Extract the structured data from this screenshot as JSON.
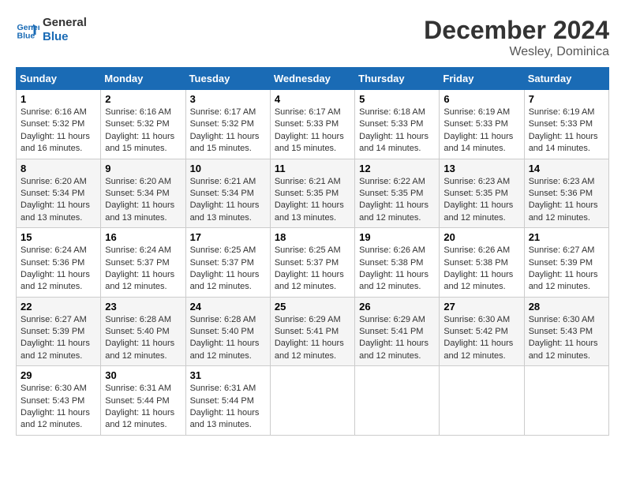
{
  "logo": {
    "line1": "General",
    "line2": "Blue"
  },
  "title": "December 2024",
  "location": "Wesley, Dominica",
  "days_of_week": [
    "Sunday",
    "Monday",
    "Tuesday",
    "Wednesday",
    "Thursday",
    "Friday",
    "Saturday"
  ],
  "weeks": [
    [
      {
        "day": "1",
        "sunrise": "6:16 AM",
        "sunset": "5:32 PM",
        "daylight": "11 hours and 16 minutes."
      },
      {
        "day": "2",
        "sunrise": "6:16 AM",
        "sunset": "5:32 PM",
        "daylight": "11 hours and 15 minutes."
      },
      {
        "day": "3",
        "sunrise": "6:17 AM",
        "sunset": "5:32 PM",
        "daylight": "11 hours and 15 minutes."
      },
      {
        "day": "4",
        "sunrise": "6:17 AM",
        "sunset": "5:33 PM",
        "daylight": "11 hours and 15 minutes."
      },
      {
        "day": "5",
        "sunrise": "6:18 AM",
        "sunset": "5:33 PM",
        "daylight": "11 hours and 14 minutes."
      },
      {
        "day": "6",
        "sunrise": "6:19 AM",
        "sunset": "5:33 PM",
        "daylight": "11 hours and 14 minutes."
      },
      {
        "day": "7",
        "sunrise": "6:19 AM",
        "sunset": "5:33 PM",
        "daylight": "11 hours and 14 minutes."
      }
    ],
    [
      {
        "day": "8",
        "sunrise": "6:20 AM",
        "sunset": "5:34 PM",
        "daylight": "11 hours and 13 minutes."
      },
      {
        "day": "9",
        "sunrise": "6:20 AM",
        "sunset": "5:34 PM",
        "daylight": "11 hours and 13 minutes."
      },
      {
        "day": "10",
        "sunrise": "6:21 AM",
        "sunset": "5:34 PM",
        "daylight": "11 hours and 13 minutes."
      },
      {
        "day": "11",
        "sunrise": "6:21 AM",
        "sunset": "5:35 PM",
        "daylight": "11 hours and 13 minutes."
      },
      {
        "day": "12",
        "sunrise": "6:22 AM",
        "sunset": "5:35 PM",
        "daylight": "11 hours and 12 minutes."
      },
      {
        "day": "13",
        "sunrise": "6:23 AM",
        "sunset": "5:35 PM",
        "daylight": "11 hours and 12 minutes."
      },
      {
        "day": "14",
        "sunrise": "6:23 AM",
        "sunset": "5:36 PM",
        "daylight": "11 hours and 12 minutes."
      }
    ],
    [
      {
        "day": "15",
        "sunrise": "6:24 AM",
        "sunset": "5:36 PM",
        "daylight": "11 hours and 12 minutes."
      },
      {
        "day": "16",
        "sunrise": "6:24 AM",
        "sunset": "5:37 PM",
        "daylight": "11 hours and 12 minutes."
      },
      {
        "day": "17",
        "sunrise": "6:25 AM",
        "sunset": "5:37 PM",
        "daylight": "11 hours and 12 minutes."
      },
      {
        "day": "18",
        "sunrise": "6:25 AM",
        "sunset": "5:37 PM",
        "daylight": "11 hours and 12 minutes."
      },
      {
        "day": "19",
        "sunrise": "6:26 AM",
        "sunset": "5:38 PM",
        "daylight": "11 hours and 12 minutes."
      },
      {
        "day": "20",
        "sunrise": "6:26 AM",
        "sunset": "5:38 PM",
        "daylight": "11 hours and 12 minutes."
      },
      {
        "day": "21",
        "sunrise": "6:27 AM",
        "sunset": "5:39 PM",
        "daylight": "11 hours and 12 minutes."
      }
    ],
    [
      {
        "day": "22",
        "sunrise": "6:27 AM",
        "sunset": "5:39 PM",
        "daylight": "11 hours and 12 minutes."
      },
      {
        "day": "23",
        "sunrise": "6:28 AM",
        "sunset": "5:40 PM",
        "daylight": "11 hours and 12 minutes."
      },
      {
        "day": "24",
        "sunrise": "6:28 AM",
        "sunset": "5:40 PM",
        "daylight": "11 hours and 12 minutes."
      },
      {
        "day": "25",
        "sunrise": "6:29 AM",
        "sunset": "5:41 PM",
        "daylight": "11 hours and 12 minutes."
      },
      {
        "day": "26",
        "sunrise": "6:29 AM",
        "sunset": "5:41 PM",
        "daylight": "11 hours and 12 minutes."
      },
      {
        "day": "27",
        "sunrise": "6:30 AM",
        "sunset": "5:42 PM",
        "daylight": "11 hours and 12 minutes."
      },
      {
        "day": "28",
        "sunrise": "6:30 AM",
        "sunset": "5:43 PM",
        "daylight": "11 hours and 12 minutes."
      }
    ],
    [
      {
        "day": "29",
        "sunrise": "6:30 AM",
        "sunset": "5:43 PM",
        "daylight": "11 hours and 12 minutes."
      },
      {
        "day": "30",
        "sunrise": "6:31 AM",
        "sunset": "5:44 PM",
        "daylight": "11 hours and 12 minutes."
      },
      {
        "day": "31",
        "sunrise": "6:31 AM",
        "sunset": "5:44 PM",
        "daylight": "11 hours and 13 minutes."
      },
      null,
      null,
      null,
      null
    ]
  ],
  "labels": {
    "sunrise": "Sunrise:",
    "sunset": "Sunset:",
    "daylight": "Daylight:"
  }
}
